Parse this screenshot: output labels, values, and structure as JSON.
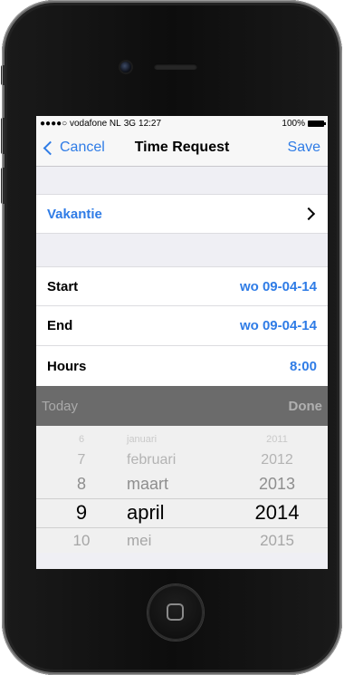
{
  "status_bar": {
    "carrier": "●●●●○ vodafone NL",
    "network": "3G",
    "time": "12:27",
    "battery": "100%"
  },
  "nav": {
    "cancel": "Cancel",
    "title": "Time Request",
    "save": "Save"
  },
  "type_row": {
    "label": "Vakantie"
  },
  "start": {
    "label": "Start",
    "value": "wo 09-04-14"
  },
  "end": {
    "label": "End",
    "value": "wo 09-04-14"
  },
  "hours": {
    "label": "Hours",
    "value": "8:00"
  },
  "picker_toolbar": {
    "today": "Today",
    "done": "Done"
  },
  "picker": {
    "rows": [
      {
        "day": "6",
        "month": "januari",
        "year": "2011"
      },
      {
        "day": "7",
        "month": "februari",
        "year": "2012"
      },
      {
        "day": "8",
        "month": "maart",
        "year": "2013"
      },
      {
        "day": "9",
        "month": "april",
        "year": "2014"
      },
      {
        "day": "10",
        "month": "mei",
        "year": "2015"
      }
    ],
    "selected_index": 3
  },
  "colors": {
    "accent": "#2f7ce6",
    "picker_bar": "#6b6b6b",
    "group_background": "#efeff4"
  }
}
